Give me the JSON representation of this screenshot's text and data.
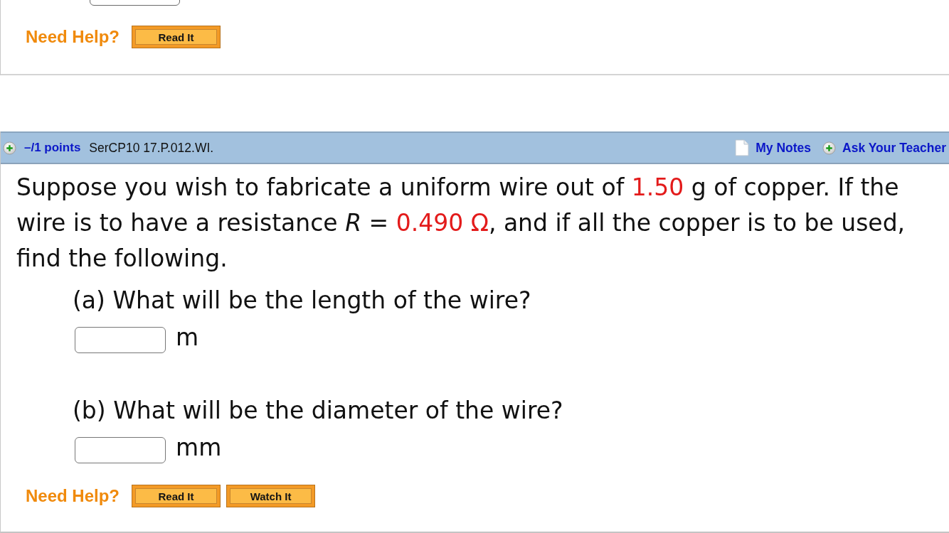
{
  "previous_question": {
    "help": {
      "label": "Need Help?",
      "buttons": [
        "Read It"
      ]
    }
  },
  "question": {
    "points": "–/1 points",
    "code": "SerCP10 17.P.012.WI.",
    "links": [
      {
        "kind": "notes",
        "label": "My Notes"
      },
      {
        "kind": "ask",
        "label": "Ask Your Teacher"
      }
    ],
    "prompt": [
      {
        "kind": "text",
        "text": "Suppose you wish to fabricate a uniform wire out of "
      },
      {
        "kind": "given",
        "text": "1.50"
      },
      {
        "kind": "text",
        "text": " g of copper. If the wire is to have a resistance *R* = "
      },
      {
        "kind": "given",
        "text": "0.490 Ω"
      },
      {
        "kind": "text",
        "text": ", and if all the copper is to be used, find the following."
      }
    ],
    "parts": [
      {
        "label": "(a) What will be the length of the wire?",
        "unit": "m"
      },
      {
        "label": "(b) What will be the diameter of the wire?",
        "unit": "mm"
      }
    ],
    "help": {
      "label": "Need Help?",
      "buttons": [
        "Read It",
        "Watch It"
      ]
    }
  }
}
